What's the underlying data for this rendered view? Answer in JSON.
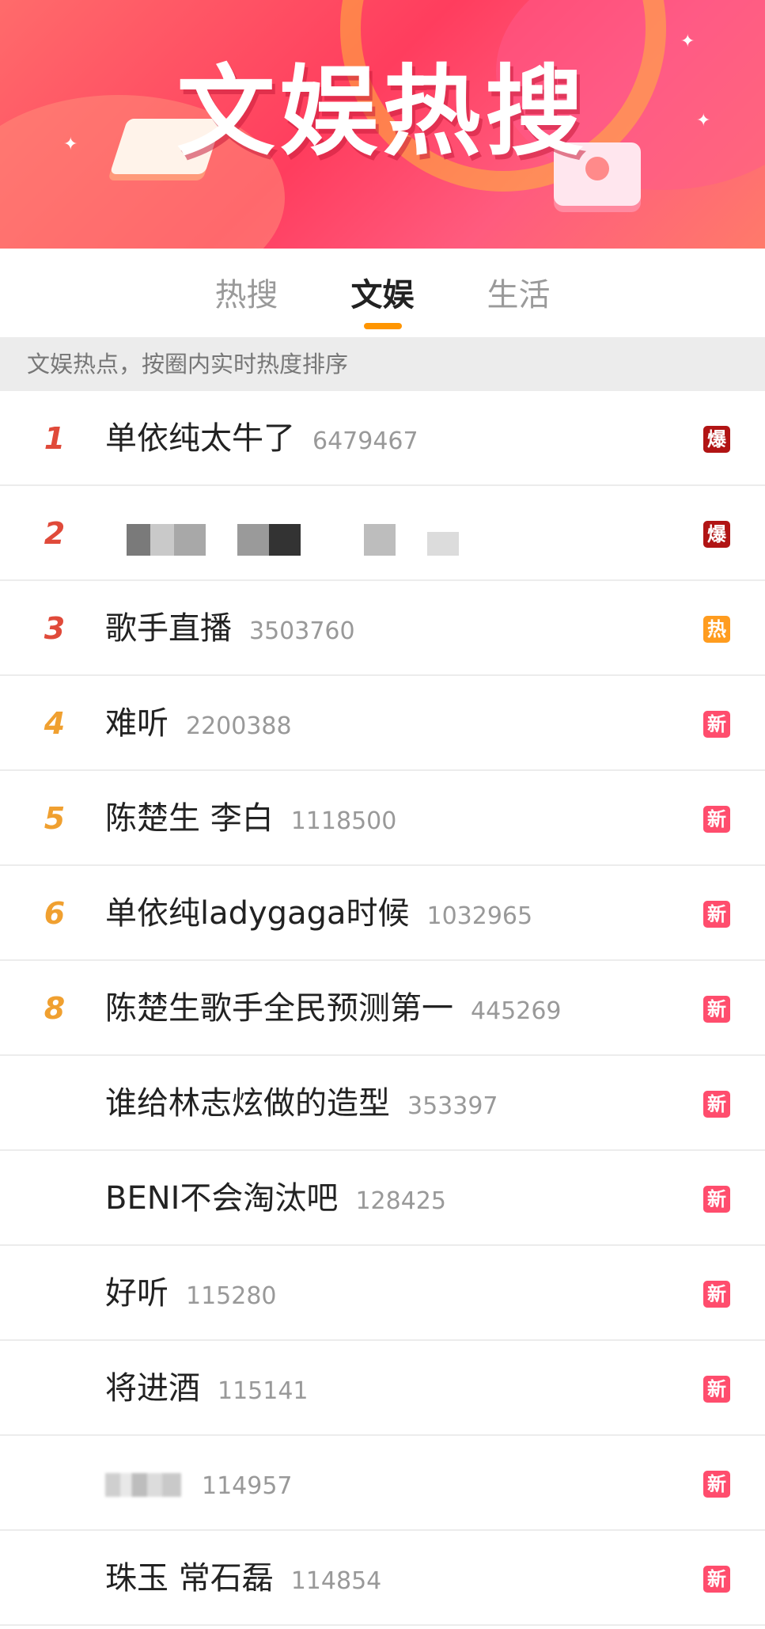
{
  "banner": {
    "title": "文娱热搜",
    "colors": {
      "bg": "#ff3d5e"
    }
  },
  "tabs": [
    {
      "label": "热搜",
      "active": false
    },
    {
      "label": "文娱",
      "active": true
    },
    {
      "label": "生活",
      "active": false
    }
  ],
  "subheader": "文娱热点，按圈内实时热度排序",
  "list": [
    {
      "rank": "1",
      "title": "单依纯太牛了",
      "count": "6479467",
      "badge": "爆",
      "badge_type": "bao",
      "rank_color": "#e04a3a"
    },
    {
      "rank": "2",
      "title": "",
      "count": "",
      "badge": "爆",
      "badge_type": "bao",
      "rank_color": "#e04a3a",
      "blurred": true
    },
    {
      "rank": "3",
      "title": "歌手直播",
      "count": "3503760",
      "badge": "热",
      "badge_type": "re",
      "rank_color": "#e04a3a"
    },
    {
      "rank": "4",
      "title": "难听",
      "count": "2200388",
      "badge": "新",
      "badge_type": "xin",
      "rank_color": "#f0a030"
    },
    {
      "rank": "5",
      "title": "陈楚生 李白",
      "count": "1118500",
      "badge": "新",
      "badge_type": "xin",
      "rank_color": "#f0a030"
    },
    {
      "rank": "6",
      "title": "单依纯ladygaga时候",
      "count": "1032965",
      "badge": "新",
      "badge_type": "xin",
      "rank_color": "#f0a030"
    },
    {
      "rank": "8",
      "title": "陈楚生歌手全民预测第一",
      "count": "445269",
      "badge": "新",
      "badge_type": "xin",
      "rank_color": "#f0a030"
    },
    {
      "rank": "",
      "title": "谁给林志炫做的造型",
      "count": "353397",
      "badge": "新",
      "badge_type": "xin",
      "rank_color": "#f0a030"
    },
    {
      "rank": "",
      "title": "BENI不会淘汰吧",
      "count": "128425",
      "badge": "新",
      "badge_type": "xin",
      "rank_color": "#f0a030"
    },
    {
      "rank": "",
      "title": "好听",
      "count": "115280",
      "badge": "新",
      "badge_type": "xin",
      "rank_color": "#f0a030"
    },
    {
      "rank": "",
      "title": "将进酒",
      "count": "115141",
      "badge": "新",
      "badge_type": "xin",
      "rank_color": "#f0a030"
    },
    {
      "rank": "",
      "title": "",
      "count": "114957",
      "badge": "新",
      "badge_type": "xin",
      "rank_color": "#f0a030",
      "title_blurred": true
    },
    {
      "rank": "",
      "title": "珠玉 常石磊",
      "count": "114854",
      "badge": "新",
      "badge_type": "xin",
      "rank_color": "#f0a030"
    }
  ]
}
